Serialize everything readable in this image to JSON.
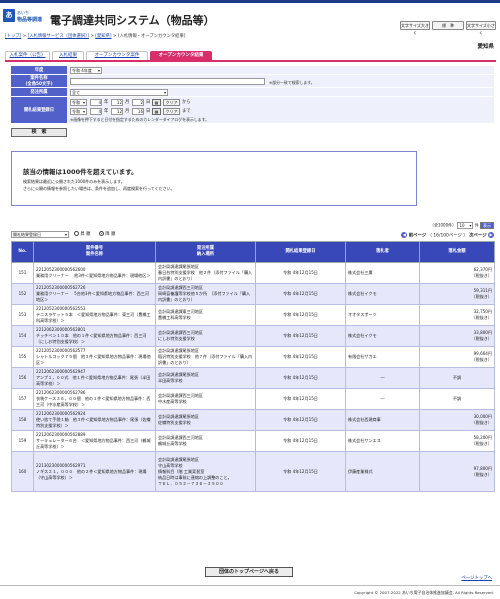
{
  "header": {
    "logo_badge": "あ",
    "logo_small": "あいち",
    "logo_name": "物品等調達",
    "system_title": "電子調達共同システム（物品等）",
    "btn_font_large": "文字サイズ大きく",
    "btn_font_standard": "標　準",
    "btn_font_small": "文字サイズ小さく"
  },
  "breadcrumb": {
    "top": "[トップ]",
    "service": "[入札情報サービス（団体選択）]",
    "sep1": " > ",
    "region": "[愛知県]",
    "sep2": " > ",
    "current": "[入札情報・オープンカウンタ結果]"
  },
  "region_label": "愛知県",
  "tabs": [
    {
      "label": "入札案件（公告）"
    },
    {
      "label": "入札結果"
    },
    {
      "label": "オープンカウンタ案件"
    },
    {
      "label": "オープンカウンタ結果"
    }
  ],
  "search": {
    "year_label": "年度",
    "year_value": "令和 4年度",
    "name_label": "案件名称",
    "name_sub": "(全角50文字)",
    "name_placeholder": "",
    "name_note": "※部分一致で検索します。",
    "org_label": "発注所属",
    "org_value": "全て",
    "date_label": "開札結果登録日",
    "era": "令和",
    "from_year": "4",
    "from_month": "12",
    "from_day": "2",
    "to_year": "4",
    "to_month": "12",
    "to_day": "16",
    "unit_year": "年",
    "unit_month": "月",
    "unit_day": "日",
    "clear_label": "クリア",
    "from_suffix": "から",
    "to_suffix": "まで",
    "date_note": "※画像を押下すると日付を指定するためのカレンダーダイアログを表示します。",
    "search_button": "検　索"
  },
  "alert": {
    "title": "該当の情報は1000件を超えています。",
    "line1": "検索結果は最近に公開された1000件のみを表示します。",
    "line2": "さらに公開の情報を参照したい場合は、条件を追加し、再度検索を行ってください。"
  },
  "listing": {
    "count_text": "（全1000件）",
    "per_page": "10",
    "per_page_suffix": "件",
    "display_btn": "表示",
    "sort_value": "開札結果登録日",
    "sort_asc": "昇 順",
    "sort_desc": "降 順",
    "prev": "前ページ",
    "page_info": "（ 16/100ページ ）",
    "next": "次ページ"
  },
  "table": {
    "headers": {
      "no": "No.",
      "item": "案件番号\n案件名称",
      "org": "発注所属\n納入場所",
      "date": "開札結果登録日",
      "winner": "落札者",
      "amount": "落札金額"
    },
    "rows": [
      {
        "no": "151",
        "code": "2212052300000562600",
        "name": "業務用クリーナー 　他3件＜愛知県地方物品事件：現場他区＞",
        "org": "会計局調達課尾張地区",
        "place": "春日台特別支援学校　他２件（添付ファイル「購入内訳書」のとおり）",
        "date": "令和 4年12月15日",
        "winner": "株式会社三庸",
        "amount": "62,370円",
        "tax": "（税抜き）"
      },
      {
        "no": "152",
        "code": "2212052300000562726",
        "name": "業務用クリーナー 　5台他3件＜愛知県地方物品事件：西三河地区＞",
        "org": "会計局調達課西三河地区",
        "place": "岡崎盲養護等学校他５か所　（添付ファイル「購入内訳書」のとおり）",
        "date": "令和 4年12月15日",
        "winner": "株式会社イクモ",
        "amount": "59,311円",
        "tax": "（税抜き）"
      },
      {
        "no": "153",
        "code": "2212052300000562553",
        "name": "テニスラケット５本　＜愛知県地方物品事件：東三河（豊橋工科高等学校）＞",
        "org": "会計局調達課東三河地区",
        "place": "豊橋工科高等学校",
        "date": "令和 4年12月15日",
        "winner": "オオタスポーツ",
        "amount": "32,750円",
        "tax": "（税抜き）"
      },
      {
        "no": "154",
        "code": "2212062300000562801",
        "name": "チッチベン１０本　他の１件＜愛知県地方物品事件：西三河（にしお特別支援学校）＞",
        "org": "会計局調達課西三河地区",
        "place": "にしお特別支援学校",
        "date": "令和 4年12月15日",
        "winner": "株式会社イクモ",
        "amount": "33,800円",
        "tax": "（税抜き）"
      },
      {
        "no": "155",
        "code": "2212052300000562577",
        "name": "シャトルコック７５個　他３件＜愛知県地方物品事件：現場他区＞",
        "org": "会計局調達課尾張地区",
        "place": "稲沢特別支援学校　他７件（添付ファイル「購入内訳書」のとおり）",
        "date": "令和 4年12月15日",
        "winner": "有限会社サカエ",
        "amount": "99,664円",
        "tax": "（税抜き）"
      },
      {
        "no": "156",
        "code": "2212062300000562947",
        "name": "アンプ１，００式　他１件＜愛知県地方物品事件：尾張（半田高等学校）＞",
        "org": "会計局調達課尾張地区",
        "place": "半田高等学校",
        "date": "令和 4年12月15日",
        "winner": "―",
        "amount": "不調",
        "tax": ""
      },
      {
        "no": "157",
        "code": "2212062300000562786",
        "name": "衣装ケース３６，００個　他の１件＜愛知県地方物品事件：西三河（中水産高等学校）＞",
        "org": "会計局調達課西三河地区",
        "place": "中水産高等学校",
        "date": "令和 4年12月15日",
        "winner": "―",
        "amount": "不調",
        "tax": ""
      },
      {
        "no": "158",
        "code": "2212062300000562924",
        "name": "使い捨て手袋１箱　他３件＜愛知県地方物品事件：尾張（佐織特別支援学校）＞",
        "org": "会計局調達課尾張地区",
        "place": "佐織特別支援学校",
        "date": "令和 4年12月15日",
        "winner": "株式会社西建商事",
        "amount": "30,000円",
        "tax": "（税抜き）"
      },
      {
        "no": "159",
        "code": "2212062300000562889",
        "name": "サーキュレーター６台　＜愛知県地方物品事件：西三河（鶴城丘高等学校）＞",
        "org": "会計局調達課西三河地区",
        "place": "鶴城丘高等学校",
        "date": "令和 4年12月15日",
        "winner": "株式会社サンエス",
        "amount": "58,200円",
        "tax": "（税抜き）"
      },
      {
        "no": "160",
        "code": "2213023000000562971",
        "name": "ノギス２１，０００　他の２件＜愛知県地方物品事件：現場（守山高等学校）＞",
        "org": "会計局調達課尾張地区",
        "place": "守山高等学校\n情報科目（階 工業実習室\n納品日時は事前に連絡の上調整のこと。\nＴＥＬ．０５２－７３６－３５００",
        "date": "令和 4年12月15日",
        "winner": "伊藤産業株式",
        "amount": "97,800円",
        "tax": "（税抜き）"
      }
    ]
  },
  "footer": {
    "back_button": "団体のトップページへ戻る",
    "page_top": "ページトップへ",
    "copyright": "Copyright © 2007-2022 あいち電子自治体推進協議会. All Rights Reserved."
  },
  "colors": {
    "accent": "#d82f6a",
    "header_blue": "#1d3a8a",
    "label_blue": "#5260c9",
    "table_head": "#3848b8",
    "row_alt": "#e6e7fa"
  }
}
